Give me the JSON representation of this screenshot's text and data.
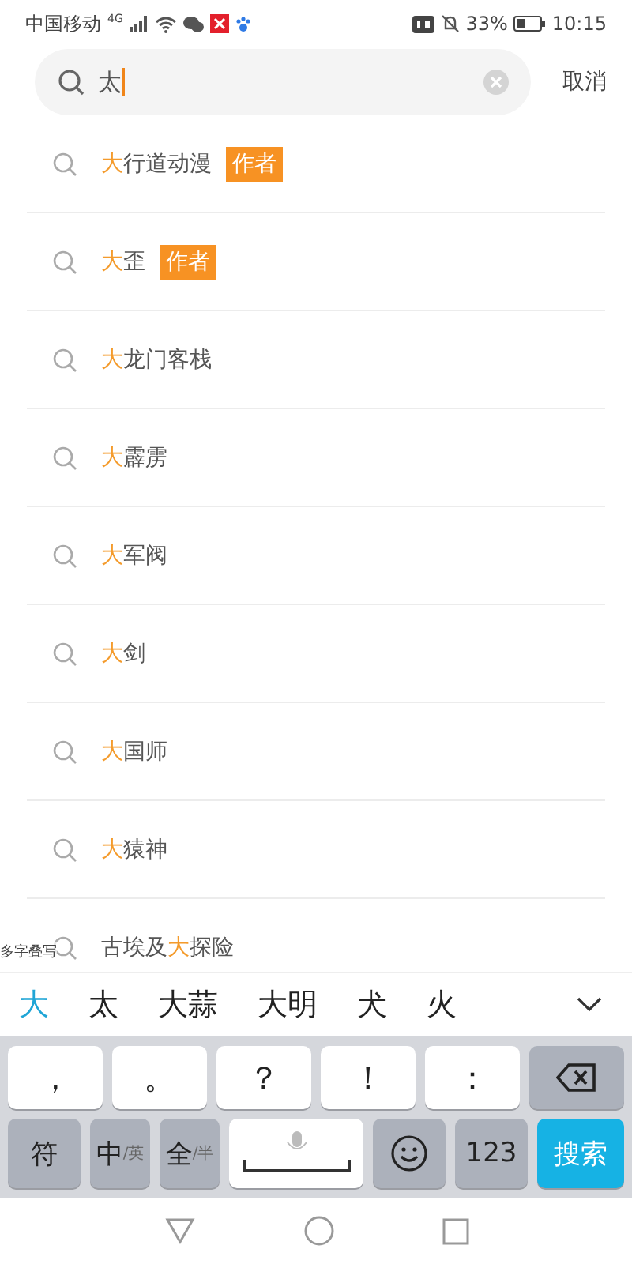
{
  "status_bar": {
    "carrier": "中国移动",
    "network": "4G",
    "battery": "33%",
    "time": "10:15"
  },
  "search": {
    "value": "太",
    "cancel": "取消"
  },
  "suggestions": [
    {
      "match": "大",
      "after": "行道动漫",
      "tag": "作者"
    },
    {
      "match": "大",
      "after": "歪",
      "tag": "作者"
    },
    {
      "match": "大",
      "after": "龙门客栈"
    },
    {
      "match": "大",
      "after": "霹雳"
    },
    {
      "match": "大",
      "after": "军阀"
    },
    {
      "match": "大",
      "after": "剑"
    },
    {
      "match": "大",
      "after": "国师"
    },
    {
      "match": "大",
      "after": "猿神"
    },
    {
      "before": "古埃及",
      "match": "大",
      "after": "探险"
    }
  ],
  "handwriting_label": "多字叠写",
  "candidates": [
    {
      "text": "大",
      "selected": true
    },
    {
      "text": "太",
      "selected": false
    },
    {
      "text": "大蒜",
      "selected": false
    },
    {
      "text": "大明",
      "selected": false
    },
    {
      "text": "犬",
      "selected": false
    },
    {
      "text": "火",
      "selected": false
    }
  ],
  "keyboard": {
    "row1": [
      {
        "kind": "char",
        "label": "，"
      },
      {
        "kind": "char",
        "label": "。"
      },
      {
        "kind": "char",
        "label": "？"
      },
      {
        "kind": "char",
        "label": "！"
      },
      {
        "kind": "char",
        "label": "："
      },
      {
        "kind": "backspace"
      }
    ],
    "row2": [
      {
        "kind": "func",
        "label": "符"
      },
      {
        "kind": "toggle",
        "label": "中",
        "sub": "/英"
      },
      {
        "kind": "toggle",
        "label": "全",
        "sub": "/半"
      },
      {
        "kind": "space"
      },
      {
        "kind": "emoji"
      },
      {
        "kind": "func",
        "label": "123"
      },
      {
        "kind": "action",
        "label": "搜索"
      }
    ]
  }
}
